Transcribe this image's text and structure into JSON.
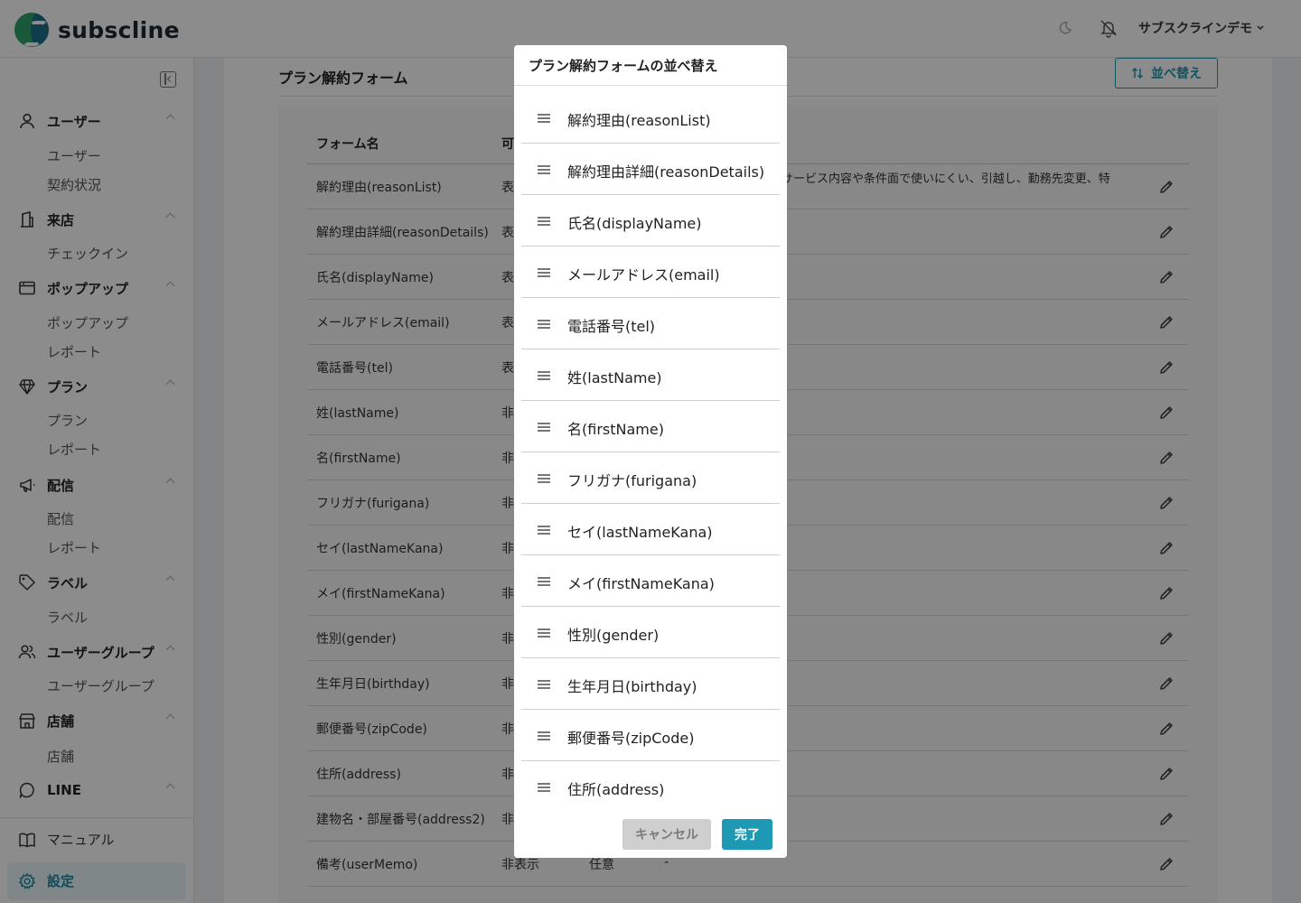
{
  "header": {
    "brand": "subscline",
    "user_menu": "サブスクラインデモ"
  },
  "sidebar": {
    "sections": [
      {
        "label": "ユーザー",
        "icon": "user-icon",
        "items": [
          "ユーザー",
          "契約状況"
        ]
      },
      {
        "label": "来店",
        "icon": "building-icon",
        "items": [
          "チェックイン"
        ]
      },
      {
        "label": "ポップアップ",
        "icon": "window-icon",
        "items": [
          "ポップアップ",
          "レポート"
        ]
      },
      {
        "label": "プラン",
        "icon": "gem-icon",
        "items": [
          "プラン",
          "レポート"
        ]
      },
      {
        "label": "配信",
        "icon": "megaphone-icon",
        "items": [
          "配信",
          "レポート"
        ]
      },
      {
        "label": "ラベル",
        "icon": "tag-icon",
        "items": [
          "ラベル"
        ]
      },
      {
        "label": "ユーザーグループ",
        "icon": "users-icon",
        "items": [
          "ユーザーグループ"
        ]
      },
      {
        "label": "店舗",
        "icon": "store-icon",
        "items": [
          "店舗"
        ]
      },
      {
        "label": "LINE",
        "icon": "chat-icon",
        "items": []
      }
    ],
    "bottom": [
      {
        "label": "マニュアル",
        "icon": "book-icon"
      },
      {
        "label": "設定",
        "icon": "gear-icon"
      }
    ]
  },
  "main": {
    "title": "プラン解約フォーム",
    "sort_button": "並べ替え",
    "headers": [
      "フォーム名",
      "可"
    ],
    "rows": [
      {
        "name": "解約理由(reasonList)",
        "display": "表",
        "required": "",
        "options": "プランの料金が高い、サービス内容や条件面で使いにくい、引越し、勤務先変更、特になし、その他"
      },
      {
        "name": "解約理由詳細(reasonDetails)",
        "display": "表",
        "required": "",
        "options": ""
      },
      {
        "name": "氏名(displayName)",
        "display": "表",
        "required": "",
        "options": ""
      },
      {
        "name": "メールアドレス(email)",
        "display": "表",
        "required": "",
        "options": ""
      },
      {
        "name": "電話番号(tel)",
        "display": "表",
        "required": "",
        "options": ""
      },
      {
        "name": "姓(lastName)",
        "display": "非",
        "required": "",
        "options": ""
      },
      {
        "name": "名(firstName)",
        "display": "非",
        "required": "",
        "options": ""
      },
      {
        "name": "フリガナ(furigana)",
        "display": "非",
        "required": "",
        "options": ""
      },
      {
        "name": "セイ(lastNameKana)",
        "display": "非",
        "required": "",
        "options": ""
      },
      {
        "name": "メイ(firstNameKana)",
        "display": "非",
        "required": "",
        "options": ""
      },
      {
        "name": "性別(gender)",
        "display": "非",
        "required": "",
        "options": ""
      },
      {
        "name": "生年月日(birthday)",
        "display": "非",
        "required": "",
        "options": ""
      },
      {
        "name": "郵便番号(zipCode)",
        "display": "非",
        "required": "",
        "options": ""
      },
      {
        "name": "住所(address)",
        "display": "非",
        "required": "",
        "options": ""
      },
      {
        "name": "建物名・部屋番号(address2)",
        "display": "非",
        "required": "",
        "options": ""
      },
      {
        "name": "備考(userMemo)",
        "display": "非表示",
        "required": "任意",
        "options": "-"
      }
    ]
  },
  "modal": {
    "title": "プラン解約フォームの並べ替え",
    "items": [
      "解約理由(reasonList)",
      "解約理由詳細(reasonDetails)",
      "氏名(displayName)",
      "メールアドレス(email)",
      "電話番号(tel)",
      "姓(lastName)",
      "名(firstName)",
      "フリガナ(furigana)",
      "セイ(lastNameKana)",
      "メイ(firstNameKana)",
      "性別(gender)",
      "生年月日(birthday)",
      "郵便番号(zipCode)",
      "住所(address)"
    ],
    "cancel_label": "キャンセル",
    "done_label": "完了"
  },
  "colors": {
    "accent": "#1d99b4",
    "brand_green": "#2fa36b",
    "brand_blue": "#1b6f8a"
  }
}
